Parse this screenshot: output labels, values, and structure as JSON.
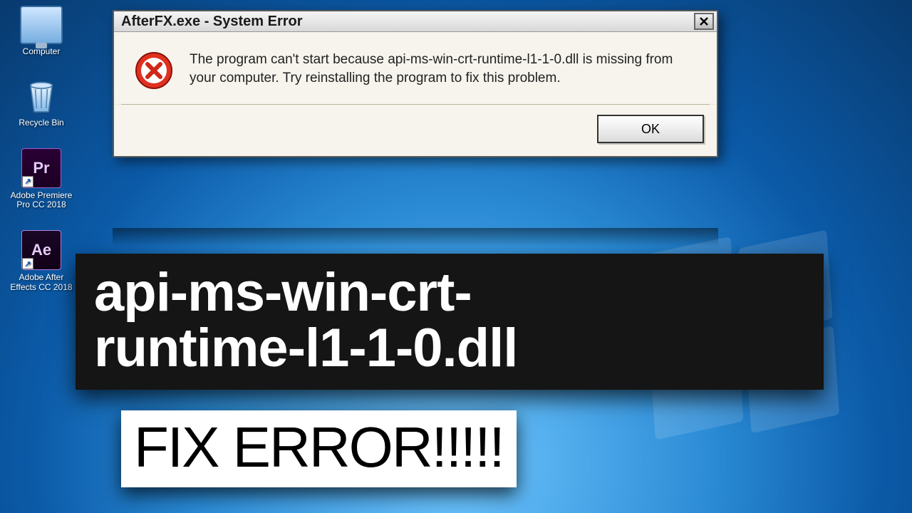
{
  "desktop": {
    "icons": [
      {
        "label": "Computer"
      },
      {
        "label": "Recycle Bin"
      },
      {
        "label": "Adobe Premiere Pro CC 2018",
        "badge": "Pr"
      },
      {
        "label": "Adobe After Effects CC 2018",
        "badge": "Ae"
      }
    ]
  },
  "dialog": {
    "title": "AfterFX.exe - System Error",
    "message": "The program can't start because api-ms-win-crt-runtime-l1-1-0.dll is missing from your computer. Try reinstalling the program to fix this problem.",
    "ok_label": "OK"
  },
  "overlay": {
    "line1": "api-ms-win-crt-",
    "line2": "runtime-l1-1-0.dll",
    "fix": "FIX ERROR!!!!!"
  }
}
